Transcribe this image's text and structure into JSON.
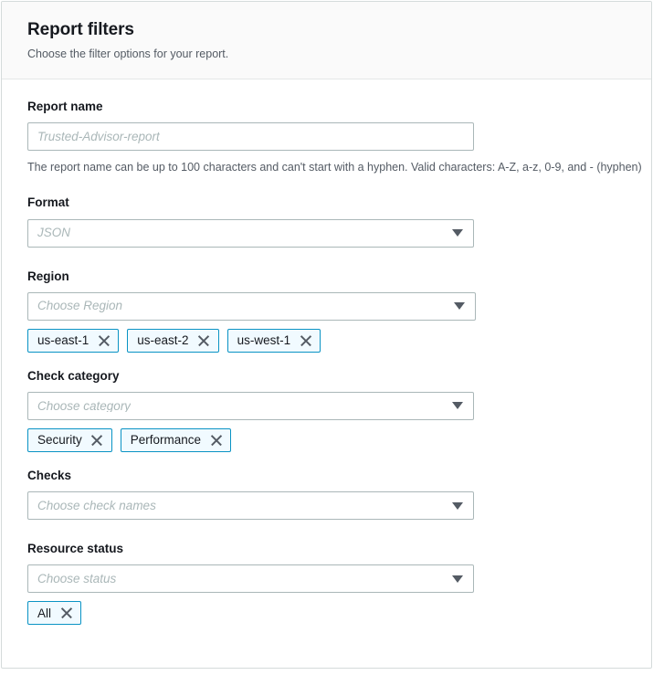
{
  "panel": {
    "title": "Report filters",
    "subtitle": "Choose the filter options for your report."
  },
  "colors": {
    "token_border": "#0a93c4",
    "token_background": "#f1faff",
    "header_background": "#fafafa",
    "panel_border": "#d5dbdb",
    "label_text": "#16191f",
    "secondary_text": "#545b64",
    "placeholder_text": "#aab7b8"
  },
  "fields": {
    "report_name": {
      "label": "Report name",
      "placeholder": "Trusted-Advisor-report",
      "value": "",
      "helper_text": "The report name can be up to 100 characters and can't start with a hyphen. Valid characters: A-Z, a-z, 0-9, and - (hyphen)"
    },
    "format": {
      "label": "Format",
      "placeholder": "JSON",
      "value": "",
      "caret_icon": "chevron-down-icon"
    },
    "region": {
      "label": "Region",
      "placeholder": "Choose Region",
      "value": "",
      "caret_icon": "chevron-down-icon",
      "tokens": [
        {
          "label": "us-east-1",
          "dismiss_icon": "close-icon"
        },
        {
          "label": "us-east-2",
          "dismiss_icon": "close-icon"
        },
        {
          "label": "us-west-1",
          "dismiss_icon": "close-icon"
        }
      ]
    },
    "check_category": {
      "label": "Check category",
      "placeholder": "Choose category",
      "value": "",
      "caret_icon": "chevron-down-icon",
      "tokens": [
        {
          "label": "Security",
          "dismiss_icon": "close-icon"
        },
        {
          "label": "Performance",
          "dismiss_icon": "close-icon"
        }
      ]
    },
    "checks": {
      "label": "Checks",
      "placeholder": "Choose check names",
      "value": "",
      "caret_icon": "chevron-down-icon"
    },
    "resource_status": {
      "label": "Resource status",
      "placeholder": "Choose status",
      "value": "",
      "caret_icon": "chevron-down-icon",
      "tokens": [
        {
          "label": "All",
          "dismiss_icon": "close-icon"
        }
      ]
    }
  }
}
